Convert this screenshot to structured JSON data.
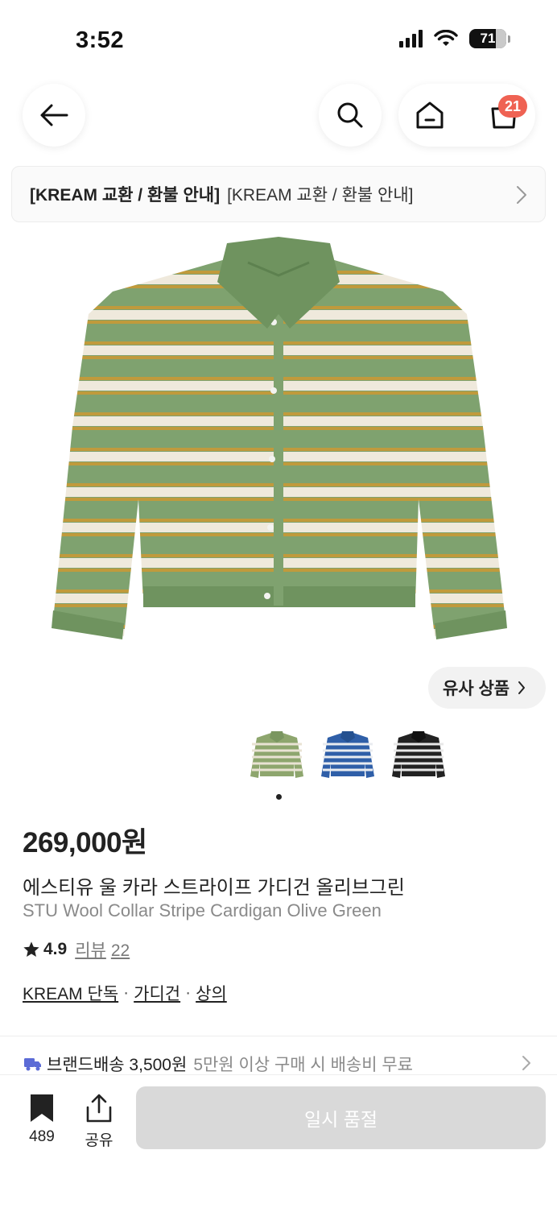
{
  "status_bar": {
    "time": "3:52",
    "battery": "71",
    "icons": [
      "signal-icon",
      "wifi-icon",
      "battery-icon"
    ]
  },
  "nav": {
    "back_icon": "arrow-left-icon",
    "search_icon": "search-icon",
    "home_icon": "home-icon",
    "cart_icon": "shopping-bag-icon",
    "cart_badge": "21"
  },
  "notice": {
    "strong": "[KREAM 교환 / 환불 안내]",
    "text": "[KREAM 교환 / 환불 안내]",
    "chevron_icon": "chevron-right-icon"
  },
  "product": {
    "image_desc_icon": "cardigan-image",
    "colors": {
      "green": "#7fa26f",
      "cream": "#efe9dc",
      "mustard": "#c09a3c"
    },
    "similar_button": "유사 상품",
    "thumbnails": [
      {
        "name": "olive-green",
        "main": "#8ea66e",
        "stripe": "#e9e3d4"
      },
      {
        "name": "blue",
        "main": "#2f5fa8",
        "stripe": "#e9ecf0"
      },
      {
        "name": "black",
        "main": "#222222",
        "stripe": "#e8e8e8"
      }
    ],
    "price": "269,000원",
    "name_ko": "에스티유 울 카라 스트라이프 가디건 올리브그린",
    "name_en": "STU Wool Collar Stripe Cardigan Olive Green",
    "rating": "4.9",
    "review_label": "리뷰",
    "review_count": "22",
    "tags": [
      "KREAM 단독",
      "가디건",
      "상의"
    ],
    "tag_separator": "·"
  },
  "shipping": {
    "icon": "truck-icon",
    "label": "브랜드배송 3,500원",
    "sub": "5만원 이상 구매 시 배송비 무료"
  },
  "bottom_bar": {
    "bookmark_count": "489",
    "share_label": "공유",
    "soldout_label": "일시 품절",
    "accent": "#d9d9d9"
  }
}
